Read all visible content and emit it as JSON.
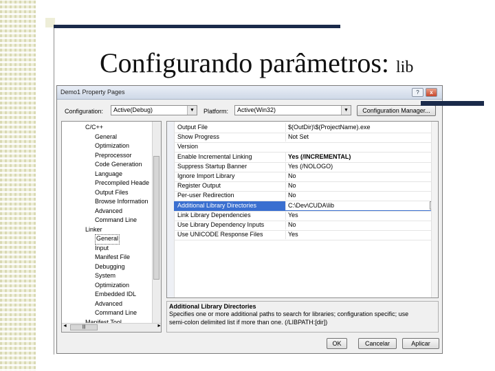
{
  "slide": {
    "title": "Configurando parâmetros:",
    "title_suffix": "lib"
  },
  "dialog": {
    "title": "Demo1 Property Pages",
    "help_icon": "?",
    "close_icon": "x",
    "configuration_label": "Configuration:",
    "configuration_value": "Active(Debug)",
    "platform_label": "Platform:",
    "platform_value": "Active(Win32)",
    "config_manager_label": "Configuration Manager...",
    "tree": [
      {
        "label": "C/C++",
        "level": 1
      },
      {
        "label": "General",
        "level": 2
      },
      {
        "label": "Optimization",
        "level": 2
      },
      {
        "label": "Preprocessor",
        "level": 2
      },
      {
        "label": "Code Generation",
        "level": 2
      },
      {
        "label": "Language",
        "level": 2
      },
      {
        "label": "Precompiled Heade",
        "level": 2
      },
      {
        "label": "Output Files",
        "level": 2
      },
      {
        "label": "Browse Information",
        "level": 2
      },
      {
        "label": "Advanced",
        "level": 2
      },
      {
        "label": "Command Line",
        "level": 2
      },
      {
        "label": "Linker",
        "level": 1
      },
      {
        "label": "General",
        "level": 2,
        "selected": true
      },
      {
        "label": "Input",
        "level": 2
      },
      {
        "label": "Manifest File",
        "level": 2
      },
      {
        "label": "Debugging",
        "level": 2
      },
      {
        "label": "System",
        "level": 2
      },
      {
        "label": "Optimization",
        "level": 2
      },
      {
        "label": "Embedded IDL",
        "level": 2
      },
      {
        "label": "Advanced",
        "level": 2
      },
      {
        "label": "Command Line",
        "level": 2
      },
      {
        "label": "Manifest Tool",
        "level": 1
      }
    ],
    "properties": [
      {
        "name": "Output File",
        "value": "$(OutDir)\\$(ProjectName).exe"
      },
      {
        "name": "Show Progress",
        "value": "Not Set"
      },
      {
        "name": "Version",
        "value": ""
      },
      {
        "name": "Enable Incremental Linking",
        "value": "Yes (/INCREMENTAL)",
        "bold": true
      },
      {
        "name": "Suppress Startup Banner",
        "value": "Yes (/NOLOGO)"
      },
      {
        "name": "Ignore Import Library",
        "value": "No"
      },
      {
        "name": "Register Output",
        "value": "No"
      },
      {
        "name": "Per-user Redirection",
        "value": "No"
      },
      {
        "name": "Additional Library Directories",
        "value": "C:\\Dev\\CUDA\\lib",
        "selected": true
      },
      {
        "name": "Link Library Dependencies",
        "value": "Yes"
      },
      {
        "name": "Use Library Dependency Inputs",
        "value": "No"
      },
      {
        "name": "Use UNICODE Response Files",
        "value": "Yes"
      }
    ],
    "ellipsis_label": "...",
    "description": {
      "heading": "Additional Library Directories",
      "line1": "Specifies one or more additional paths to search for libraries; configuration specific; use",
      "line2": "semi-colon delimited list if more than one.     (/LIBPATH:[dir])"
    },
    "buttons": {
      "ok": "OK",
      "cancel": "Cancelar",
      "apply": "Aplicar"
    }
  }
}
